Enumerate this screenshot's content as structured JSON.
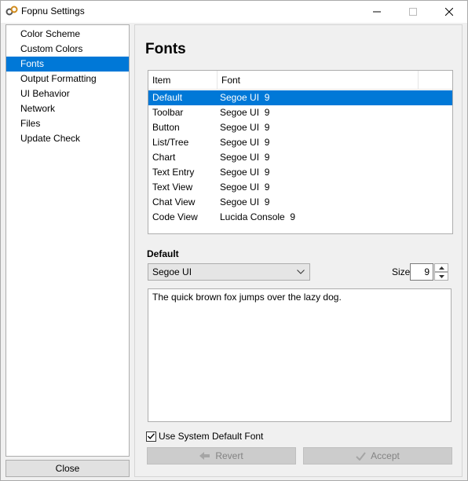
{
  "window": {
    "title": "Fopnu Settings",
    "icon": "fopnu-logo-icon"
  },
  "sidebar": {
    "items": [
      {
        "label": "Color Scheme"
      },
      {
        "label": "Custom Colors"
      },
      {
        "label": "Fonts",
        "selected": true
      },
      {
        "label": "Output Formatting"
      },
      {
        "label": "UI Behavior"
      },
      {
        "label": "Network"
      },
      {
        "label": "Files"
      },
      {
        "label": "Update Check"
      }
    ],
    "close_label": "Close"
  },
  "main": {
    "title": "Fonts",
    "table": {
      "columns": [
        "Item",
        "Font"
      ],
      "rows": [
        {
          "item": "Default",
          "font": "Segoe UI  9",
          "selected": true
        },
        {
          "item": "Toolbar",
          "font": "Segoe UI  9"
        },
        {
          "item": "Button",
          "font": "Segoe UI  9"
        },
        {
          "item": "List/Tree",
          "font": "Segoe UI  9"
        },
        {
          "item": "Chart",
          "font": "Segoe UI  9"
        },
        {
          "item": "Text Entry",
          "font": "Segoe UI  9"
        },
        {
          "item": "Text View",
          "font": "Segoe UI  9"
        },
        {
          "item": "Chat View",
          "font": "Segoe UI  9"
        },
        {
          "item": "Code View",
          "font": "Lucida Console  9"
        }
      ]
    },
    "selected_section_label": "Default",
    "font_select_value": "Segoe UI",
    "size_label": "Size",
    "size_value": "9",
    "preview_text": "The quick brown fox jumps over the lazy dog.",
    "use_system_default_label": "Use System Default Font",
    "use_system_default_checked": true,
    "revert_label": "Revert",
    "accept_label": "Accept"
  },
  "colors": {
    "accent": "#0078d7",
    "window_bg": "#f0f0f0",
    "disabled_text": "#838383"
  }
}
